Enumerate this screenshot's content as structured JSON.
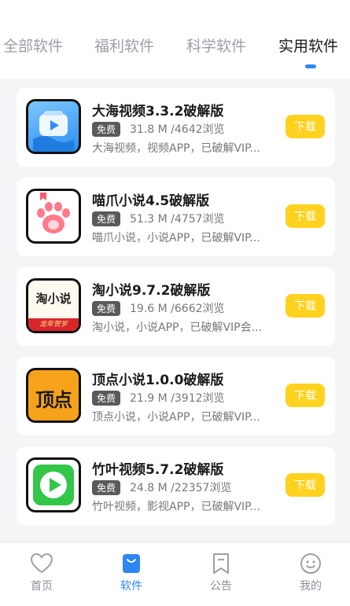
{
  "tabs": [
    {
      "label": "全部软件",
      "active": false
    },
    {
      "label": "福利软件",
      "active": false
    },
    {
      "label": "科学软件",
      "active": false
    },
    {
      "label": "实用软件",
      "active": true
    }
  ],
  "apps": [
    {
      "title": "大海视频3.3.2破解版",
      "badge": "免费",
      "stats": "31.8 M /4642浏览",
      "desc": "大海视频，视频APP，已破解VIP...",
      "download": "下载",
      "icon": "play-icon"
    },
    {
      "title": "喵爪小说4.5破解版",
      "badge": "免费",
      "stats": "51.3 M /4757浏览",
      "desc": "喵爪小说，小说APP，已破解VIP...",
      "download": "下载",
      "icon": "paw-icon"
    },
    {
      "title": "淘小说9.7.2破解版",
      "badge": "免费",
      "stats": "19.6 M /6662浏览",
      "desc": "淘小说，小说APP，已破解VIP会...",
      "download": "下载",
      "icon": "taoxiaoshuo-logo",
      "icon_text": "淘小说",
      "icon_sub": "龙年贺岁"
    },
    {
      "title": "顶点小说1.0.0破解版",
      "badge": "免费",
      "stats": "21.9 M /3912浏览",
      "desc": "顶点小说，小说APP，已破解VIP...",
      "download": "下载",
      "icon": "dingdian-logo",
      "icon_text": "顶点"
    },
    {
      "title": "竹叶视频5.7.2破解版",
      "badge": "免费",
      "stats": "24.8 M /22357浏览",
      "desc": "竹叶视频，影视APP，已破解VIP...",
      "download": "下载",
      "icon": "play-icon"
    }
  ],
  "nav": [
    {
      "label": "首页",
      "icon": "heart-icon",
      "active": false
    },
    {
      "label": "软件",
      "icon": "shopping-bag-icon",
      "active": true
    },
    {
      "label": "公告",
      "icon": "bookmark-icon",
      "active": false
    },
    {
      "label": "我的",
      "icon": "smiley-icon",
      "active": false
    }
  ],
  "colors": {
    "accent": "#2e86f5",
    "download": "#ffd21f",
    "badge": "#5a5a5a"
  }
}
